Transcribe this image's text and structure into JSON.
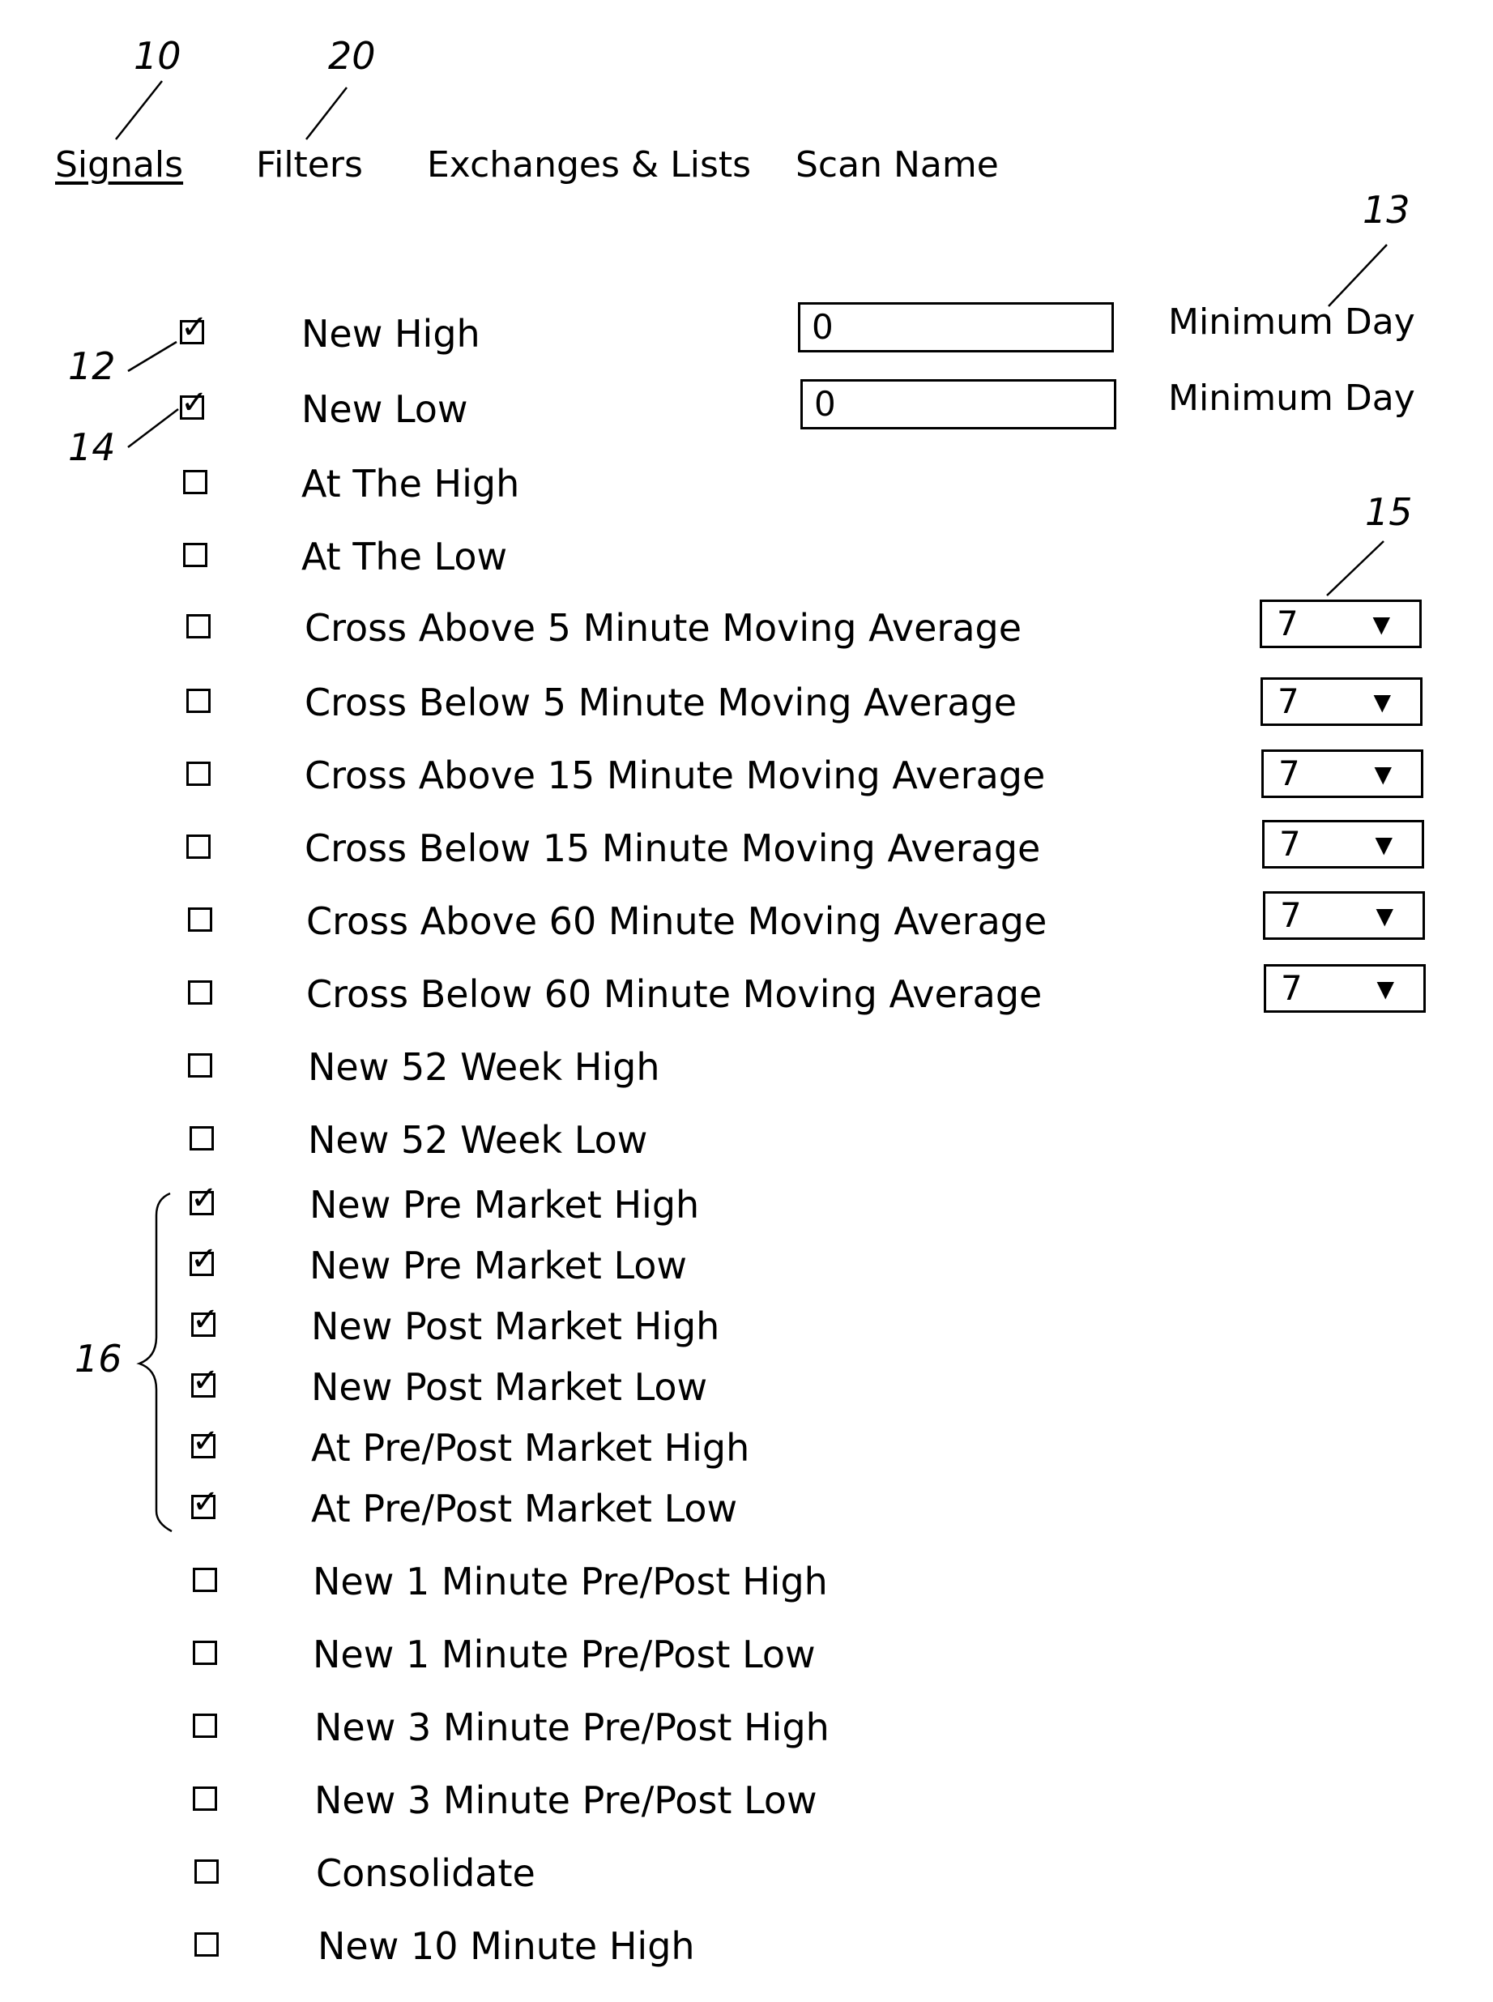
{
  "tabs": [
    {
      "label": "Signals",
      "active": true
    },
    {
      "label": "Filters",
      "active": false
    },
    {
      "label": "Exchanges & Lists",
      "active": false
    },
    {
      "label": "Scan Name",
      "active": false
    }
  ],
  "reference_numerals": {
    "signals_tab": "10",
    "filters_tab": "20",
    "checkbox_new_high": "12",
    "min_day_label": "13",
    "checkbox_new_low": "14",
    "dropdown": "15",
    "premarket_group": "16"
  },
  "signals": [
    {
      "label": "New High",
      "checked": true,
      "input_value": "0",
      "input_label": "Minimum Day"
    },
    {
      "label": "New Low",
      "checked": true,
      "input_value": "0",
      "input_label": "Minimum Day"
    },
    {
      "label": "At The High",
      "checked": false
    },
    {
      "label": "At The Low",
      "checked": false
    },
    {
      "label": "Cross Above 5 Minute Moving Average",
      "checked": false,
      "dropdown_value": "7"
    },
    {
      "label": "Cross Below 5 Minute Moving Average",
      "checked": false,
      "dropdown_value": "7"
    },
    {
      "label": "Cross Above 15 Minute Moving Average",
      "checked": false,
      "dropdown_value": "7"
    },
    {
      "label": "Cross Below 15 Minute Moving Average",
      "checked": false,
      "dropdown_value": "7"
    },
    {
      "label": "Cross Above 60 Minute Moving Average",
      "checked": false,
      "dropdown_value": "7"
    },
    {
      "label": "Cross Below 60 Minute Moving Average",
      "checked": false,
      "dropdown_value": "7"
    },
    {
      "label": "New 52 Week High",
      "checked": false
    },
    {
      "label": "New 52 Week Low",
      "checked": false
    },
    {
      "label": "New Pre Market High",
      "checked": true
    },
    {
      "label": "New Pre Market Low",
      "checked": true
    },
    {
      "label": "New Post Market High",
      "checked": true
    },
    {
      "label": "New Post Market Low",
      "checked": true
    },
    {
      "label": "At Pre/Post Market High",
      "checked": true
    },
    {
      "label": "At Pre/Post Market Low",
      "checked": true
    },
    {
      "label": "New 1 Minute Pre/Post High",
      "checked": false
    },
    {
      "label": "New 1 Minute Pre/Post Low",
      "checked": false
    },
    {
      "label": "New 3 Minute Pre/Post High",
      "checked": false
    },
    {
      "label": "New 3 Minute Pre/Post Low",
      "checked": false
    },
    {
      "label": "Consolidate",
      "checked": false
    },
    {
      "label": "New 10 Minute High",
      "checked": false
    }
  ],
  "icons": {
    "check": "✓",
    "dropdown_arrow": "▼"
  }
}
